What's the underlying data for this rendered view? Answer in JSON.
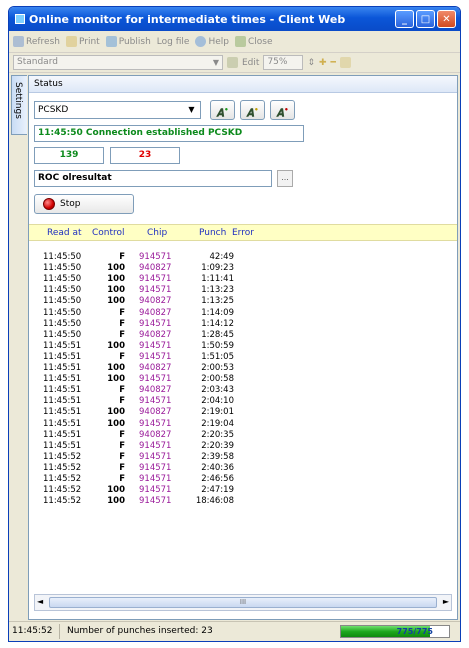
{
  "window": {
    "title": "Online monitor for intermediate times - Client Web"
  },
  "toolbar": {
    "refresh": "Refresh",
    "print": "Print",
    "publish": "Publish",
    "logfile": "Log file",
    "help": "Help",
    "close": "Close"
  },
  "toolbar2": {
    "layout": "Standard",
    "edit": "Edit",
    "zoom": "75%"
  },
  "sidebar": {
    "settings_tab": "Settings"
  },
  "status": {
    "header": "Status",
    "source": "PCSKD",
    "connection": "11:45:50 Connection established PCSKD",
    "count_green": "139",
    "count_red": "23",
    "output": "ROC olresultat",
    "browse": "...",
    "stop_label": "Stop"
  },
  "grid": {
    "columns": {
      "read_at": "Read at",
      "control": "Control",
      "chip": "Chip",
      "punch": "Punch",
      "error": "Error"
    },
    "rows": [
      {
        "time": "11:45:50",
        "control": "F",
        "chip": "914571",
        "punch": "42:49"
      },
      {
        "time": "11:45:50",
        "control": "100",
        "chip": "940827",
        "punch": "1:09:23"
      },
      {
        "time": "11:45:50",
        "control": "100",
        "chip": "914571",
        "punch": "1:11:41"
      },
      {
        "time": "11:45:50",
        "control": "100",
        "chip": "914571",
        "punch": "1:13:23"
      },
      {
        "time": "11:45:50",
        "control": "100",
        "chip": "940827",
        "punch": "1:13:25"
      },
      {
        "time": "11:45:50",
        "control": "F",
        "chip": "940827",
        "punch": "1:14:09"
      },
      {
        "time": "11:45:50",
        "control": "F",
        "chip": "914571",
        "punch": "1:14:12"
      },
      {
        "time": "11:45:50",
        "control": "F",
        "chip": "940827",
        "punch": "1:28:45"
      },
      {
        "time": "11:45:51",
        "control": "100",
        "chip": "914571",
        "punch": "1:50:59"
      },
      {
        "time": "11:45:51",
        "control": "F",
        "chip": "914571",
        "punch": "1:51:05"
      },
      {
        "time": "11:45:51",
        "control": "100",
        "chip": "940827",
        "punch": "2:00:53"
      },
      {
        "time": "11:45:51",
        "control": "100",
        "chip": "914571",
        "punch": "2:00:58"
      },
      {
        "time": "11:45:51",
        "control": "F",
        "chip": "940827",
        "punch": "2:03:43"
      },
      {
        "time": "11:45:51",
        "control": "F",
        "chip": "914571",
        "punch": "2:04:10"
      },
      {
        "time": "11:45:51",
        "control": "100",
        "chip": "940827",
        "punch": "2:19:01"
      },
      {
        "time": "11:45:51",
        "control": "100",
        "chip": "914571",
        "punch": "2:19:04"
      },
      {
        "time": "11:45:51",
        "control": "F",
        "chip": "940827",
        "punch": "2:20:35"
      },
      {
        "time": "11:45:51",
        "control": "F",
        "chip": "914571",
        "punch": "2:20:39"
      },
      {
        "time": "11:45:52",
        "control": "F",
        "chip": "914571",
        "punch": "2:39:58"
      },
      {
        "time": "11:45:52",
        "control": "F",
        "chip": "914571",
        "punch": "2:40:36"
      },
      {
        "time": "11:45:52",
        "control": "F",
        "chip": "914571",
        "punch": "2:46:56"
      },
      {
        "time": "11:45:52",
        "control": "100",
        "chip": "914571",
        "punch": "2:47:19"
      },
      {
        "time": "11:45:52",
        "control": "100",
        "chip": "914571",
        "punch": "18:46:08"
      }
    ]
  },
  "scrollbar": {
    "thumb_grip": "III",
    "left": "◄",
    "right": "►"
  },
  "statusbar": {
    "time": "11:45:52",
    "message": "Number of punches inserted: 23",
    "progress_label": "775/775",
    "progress_fraction": 1.0
  },
  "icons": {
    "refresh": "refresh-icon",
    "print": "print-icon",
    "publish": "publish-icon",
    "help": "help-icon",
    "close": "close-icon",
    "stop": "stop-icon",
    "minimize": "minimize-icon",
    "maximize": "maximize-icon",
    "window_close": "close-icon"
  },
  "colors": {
    "connection_text": "#0c8a1c",
    "count_red": "#e00000",
    "chip_text": "#9a1a9a",
    "header_bg": "#ffffc4",
    "progress_fill": "#1ea81e"
  }
}
